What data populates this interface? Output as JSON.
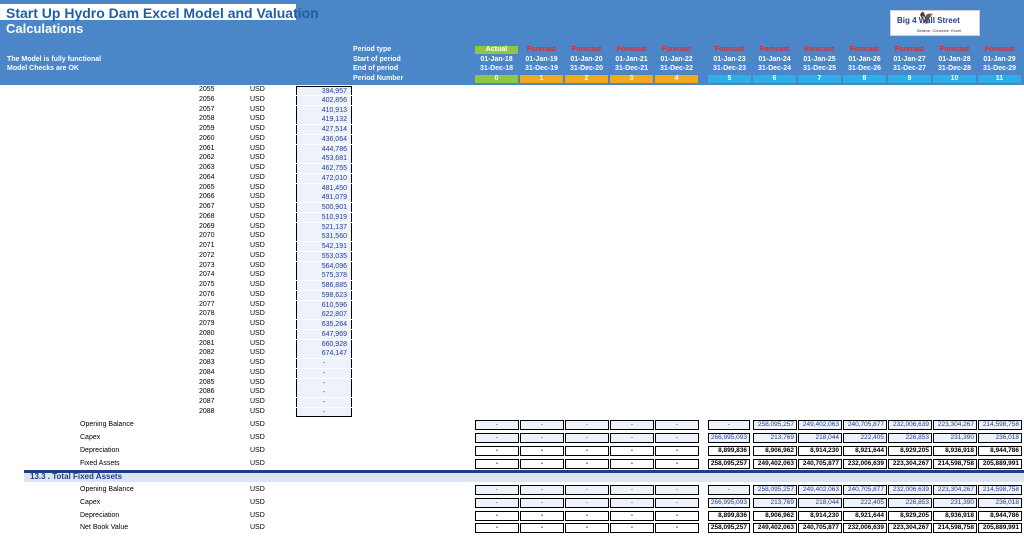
{
  "header": {
    "title": "Start Up Hydro Dam Excel Model and Valuation",
    "subtitle": "Calculations",
    "status_1": "The Model is fully functional",
    "status_2": "Model Checks are OK",
    "logo_text": "Big 4 Wall Street",
    "logo_tagline": "Believe. Conceive. Excel.",
    "labels": [
      "Period type",
      "Start of period",
      "End of period",
      "Period Number"
    ]
  },
  "periods": {
    "types": [
      "Actual",
      "Forecast",
      "Forecast",
      "Forecast",
      "Forecast",
      "Forecast",
      "Forecast",
      "Forecast",
      "Forecast",
      "Forecast",
      "Forecast",
      "Forecast"
    ],
    "starts": [
      "01-Jan-18",
      "01-Jan-19",
      "01-Jan-20",
      "01-Jan-21",
      "01-Jan-22",
      "01-Jan-23",
      "01-Jan-24",
      "01-Jan-25",
      "01-Jan-26",
      "01-Jan-27",
      "01-Jan-28",
      "01-Jan-29"
    ],
    "ends": [
      "31-Dec-18",
      "31-Dec-19",
      "31-Dec-20",
      "31-Dec-21",
      "31-Dec-22",
      "31-Dec-23",
      "31-Dec-24",
      "31-Dec-25",
      "31-Dec-26",
      "31-Dec-27",
      "31-Dec-28",
      "31-Dec-29"
    ],
    "numbers": [
      "0",
      "1",
      "2",
      "3",
      "4",
      "5",
      "6",
      "7",
      "8",
      "9",
      "10",
      "11"
    ]
  },
  "schedule": {
    "years": [
      "2055",
      "2056",
      "2057",
      "2058",
      "2059",
      "2060",
      "2061",
      "2062",
      "2063",
      "2064",
      "2065",
      "2066",
      "2067",
      "2068",
      "2069",
      "2070",
      "2071",
      "2072",
      "2073",
      "2074",
      "2075",
      "2076",
      "2077",
      "2078",
      "2079",
      "2080",
      "2081",
      "2082",
      "2083",
      "2084",
      "2085",
      "2086",
      "2087",
      "2088"
    ],
    "values": [
      "394,957",
      "402,856",
      "410,913",
      "419,132",
      "427,514",
      "436,064",
      "444,786",
      "453,681",
      "462,755",
      "472,010",
      "481,450",
      "491,079",
      "500,901",
      "510,919",
      "521,137",
      "531,560",
      "542,191",
      "553,035",
      "564,096",
      "575,378",
      "586,885",
      "598,623",
      "610,596",
      "622,807",
      "635,264",
      "647,969",
      "660,928",
      "674,147",
      "-",
      "-",
      "-",
      "-",
      "-",
      "-"
    ],
    "currency": "USD"
  },
  "block1": {
    "rows": [
      {
        "label": "Opening Balance",
        "currency": "USD",
        "values": [
          "-",
          "-",
          "-",
          "-",
          "-",
          "-",
          "258,095,257",
          "249,402,063",
          "240,705,877",
          "232,006,639",
          "223,304,267",
          "214,598,758"
        ]
      },
      {
        "label": "Capex",
        "currency": "USD",
        "values": [
          "-",
          "-",
          "-",
          "-",
          "-",
          "266,995,093",
          "213,769",
          "218,044",
          "222,405",
          "226,853",
          "231,390",
          "236,018"
        ]
      },
      {
        "label": "Depreciation",
        "currency": "USD",
        "values": [
          "-",
          "-",
          "-",
          "-",
          "-",
          "8,899,836",
          "8,906,962",
          "8,914,230",
          "8,921,644",
          "8,929,205",
          "8,936,918",
          "8,944,786"
        ]
      },
      {
        "label": "Fixed Assets",
        "currency": "USD",
        "values": [
          "-",
          "-",
          "-",
          "-",
          "-",
          "258,095,257",
          "249,402,063",
          "240,705,877",
          "232,006,639",
          "223,304,267",
          "214,598,758",
          "205,889,991"
        ]
      }
    ]
  },
  "section": {
    "title": "13.3 . Total Fixed Assets"
  },
  "block2": {
    "rows": [
      {
        "label": "Opening Balance",
        "currency": "USD",
        "values": [
          "-",
          "-",
          "-",
          "-",
          "-",
          "-",
          "258,095,257",
          "249,402,063",
          "240,705,877",
          "232,006,639",
          "223,304,267",
          "214,598,758"
        ]
      },
      {
        "label": "Capex",
        "currency": "USD",
        "values": [
          "-",
          "-",
          "-",
          "-",
          "-",
          "266,995,093",
          "213,769",
          "218,044",
          "222,405",
          "226,853",
          "231,390",
          "236,018"
        ]
      },
      {
        "label": "Depreciation",
        "currency": "USD",
        "values": [
          "-",
          "-",
          "-",
          "-",
          "-",
          "8,899,836",
          "8,906,962",
          "8,914,230",
          "8,921,644",
          "8,929,205",
          "8,936,918",
          "8,944,786"
        ]
      },
      {
        "label": "Net Book Value",
        "currency": "USD",
        "values": [
          "-",
          "-",
          "-",
          "-",
          "-",
          "258,095,257",
          "249,402,063",
          "240,705,877",
          "232,006,639",
          "223,304,267",
          "214,598,758",
          "205,889,991"
        ]
      }
    ]
  }
}
